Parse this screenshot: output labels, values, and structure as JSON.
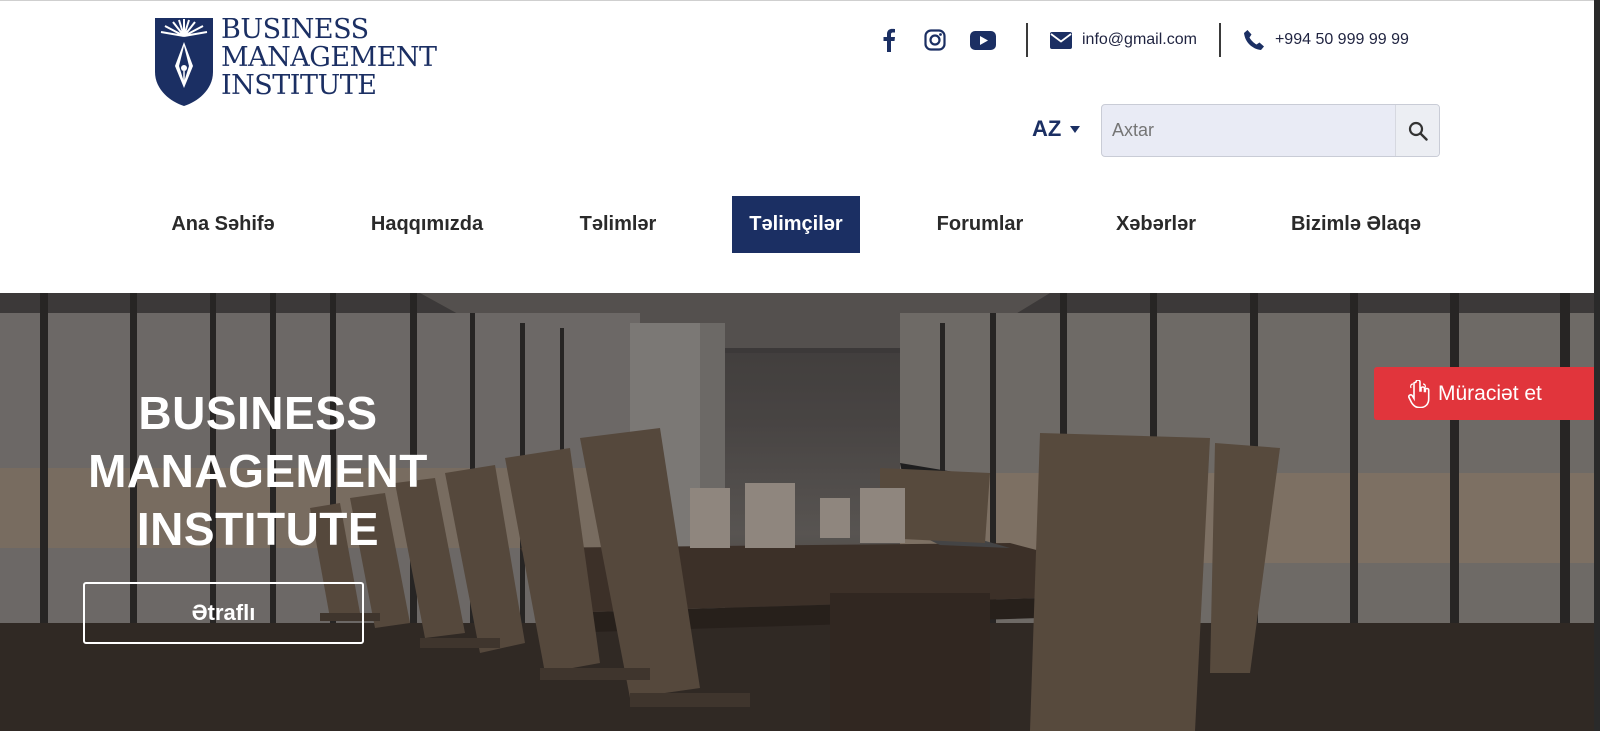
{
  "logo": {
    "line1": "BUSINESS",
    "line2": "MANAGEMENT",
    "line3": "INSTITUTE"
  },
  "contacts": {
    "email": "info@gmail.com",
    "phone": "+994 50 999 99 99",
    "social": [
      "facebook-icon",
      "instagram-icon",
      "youtube-icon"
    ]
  },
  "language": {
    "selected": "AZ"
  },
  "search": {
    "placeholder": "Axtar"
  },
  "nav": {
    "items": [
      {
        "label": "Ana Səhifə",
        "active": false
      },
      {
        "label": "Haqqımızda",
        "active": false
      },
      {
        "label": "Təlimlər",
        "active": false
      },
      {
        "label": "Təlimçilər",
        "active": true
      },
      {
        "label": "Forumlar",
        "active": false
      },
      {
        "label": "Xəbərlər",
        "active": false
      },
      {
        "label": "Bizimlə Əlaqə",
        "active": false
      }
    ]
  },
  "hero": {
    "title_line1": "BUSINESS",
    "title_line2": "MANAGEMENT",
    "title_line3": "INSTITUTE",
    "more_label": "Ətraflı",
    "apply_label": "Müraciət et"
  },
  "colors": {
    "brand": "#1b2f63",
    "accent": "#e1353c"
  }
}
